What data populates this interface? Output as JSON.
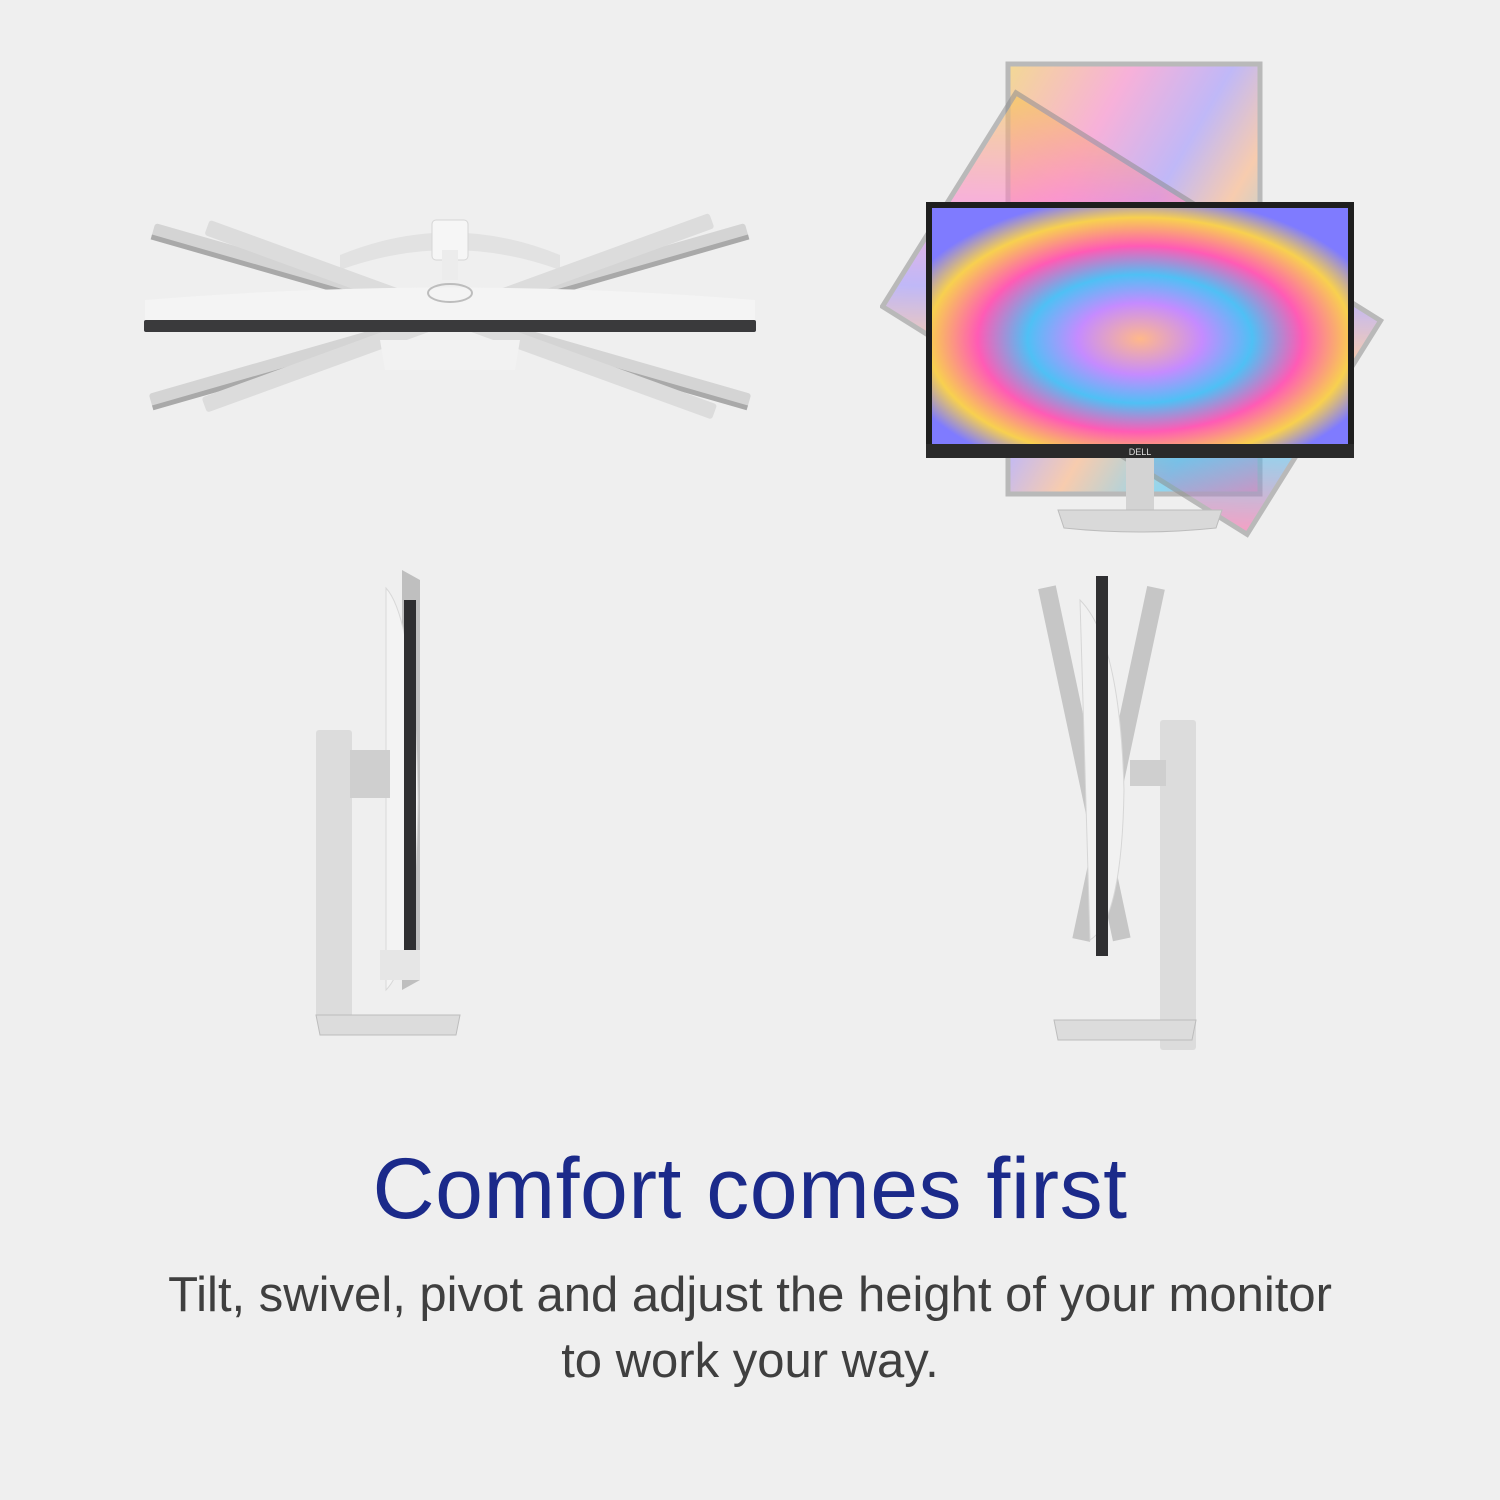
{
  "headline": "Comfort comes first",
  "description": {
    "line1": "Tilt, swivel, pivot and adjust the height of your monitor",
    "line2": "to work your way."
  },
  "brand_logo": "DELL",
  "colors": {
    "background": "#efefef",
    "headline": "#1b2a8a",
    "body_text": "#3f3f3f",
    "bezel": "#333333",
    "silver": "#c9c9c9"
  }
}
